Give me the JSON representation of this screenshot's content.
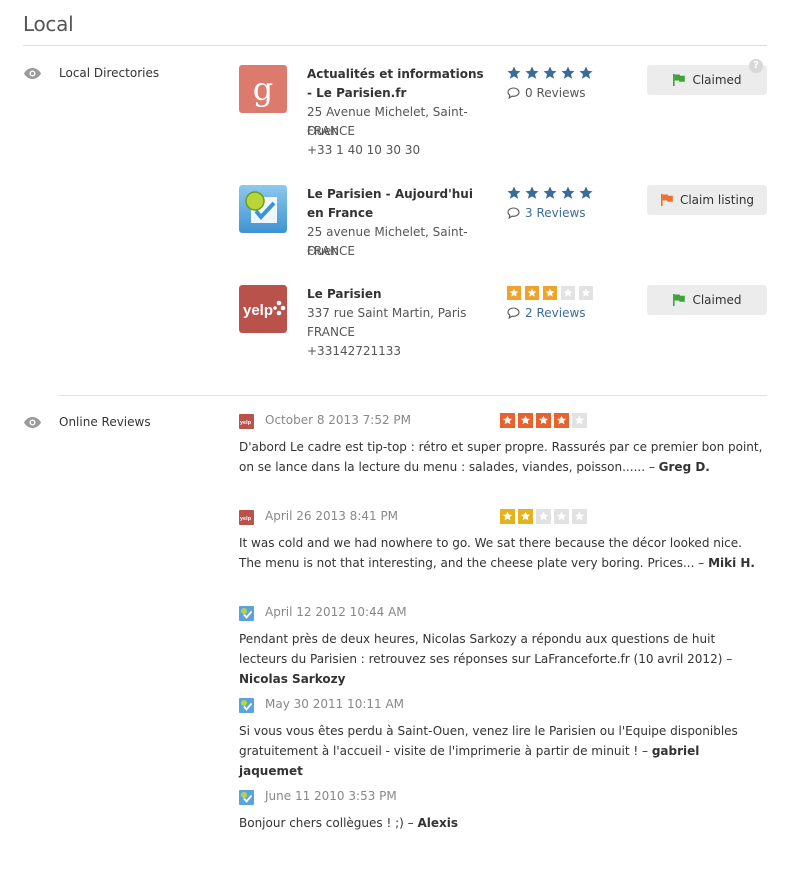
{
  "page": {
    "title": "Local"
  },
  "colors": {
    "link": "#3b6c99",
    "star_blue": "#3b6c99",
    "star_orange": "#f0a32b",
    "star_red": "#e8612f",
    "star_gold": "#e4b21f",
    "flag_green": "#3da33a",
    "flag_orange": "#e9722c"
  },
  "local_directories": {
    "label": "Local Directories",
    "listings": [
      {
        "source_icon": "google-icon",
        "name": "Actualités et informations - Le Parisien.fr",
        "address_lines": [
          "25 Avenue Michelet, Saint-Ouen",
          "FRANCE",
          "+33 1 40 10 30 30"
        ],
        "rating": 5,
        "star_style": "blue",
        "reviews_label": "0 Reviews",
        "reviews_is_link": false,
        "status": "Claimed",
        "status_flag": "green",
        "show_help": true
      },
      {
        "source_icon": "foursquare-icon",
        "name": "Le Parisien - Aujourd'hui en France",
        "address_lines": [
          "25 avenue Michelet, Saint-Ouen",
          "FRANCE"
        ],
        "rating": 5,
        "star_style": "blue",
        "reviews_label": "3 Reviews",
        "reviews_is_link": true,
        "status": "Claim listing",
        "status_flag": "orange",
        "show_help": false
      },
      {
        "source_icon": "yelp-icon",
        "name": "Le Parisien",
        "address_lines": [
          "337 rue Saint Martin, Paris",
          "FRANCE",
          "+33142721133"
        ],
        "rating": 3,
        "star_style": "orange",
        "reviews_label": "2 Reviews",
        "reviews_is_link": true,
        "status": "Claimed",
        "status_flag": "green",
        "show_help": false
      }
    ]
  },
  "online_reviews": {
    "label": "Online Reviews",
    "reviews": [
      {
        "source_icon": "yelp-icon",
        "date": "October 8 2013 7:52 PM",
        "rating": 4,
        "star_style": "red",
        "text": "D'abord Le cadre est tip-top : rétro et super propre. Rassurés par ce premier bon point, on se lance dans la lecture du menu : salades, viandes, poisson...... –",
        "author": "Greg D."
      },
      {
        "source_icon": "yelp-icon",
        "date": "April 26 2013 8:41 PM",
        "rating": 2,
        "star_style": "gold",
        "text": "It was cold and we had nowhere to go. We sat there because the décor looked nice. The menu is not that interesting, and the cheese plate very boring. Prices... –",
        "author": "Miki H."
      },
      {
        "source_icon": "foursquare-icon",
        "date": "April 12 2012 10:44 AM",
        "rating": 0,
        "star_style": "none",
        "text": "Pendant près de deux heures, Nicolas Sarkozy a répondu aux questions de huit lecteurs du Parisien : retrouvez ses réponses sur LaFranceforte.fr (10 avril 2012) –",
        "author": "Nicolas Sarkozy"
      },
      {
        "source_icon": "foursquare-icon",
        "date": "May 30 2011 10:11 AM",
        "rating": 0,
        "star_style": "none",
        "text": "Si vous vous êtes perdu à Saint-Ouen, venez lire le Parisien ou l'Equipe disponibles gratuitement à l'accueil - visite de l'imprimerie à partir de minuit ! –",
        "author": "gabriel jaquemet"
      },
      {
        "source_icon": "foursquare-icon",
        "date": "June 11 2010 3:53 PM",
        "rating": 0,
        "star_style": "none",
        "text": "Bonjour chers collègues ! ;) –",
        "author": "Alexis"
      }
    ]
  }
}
